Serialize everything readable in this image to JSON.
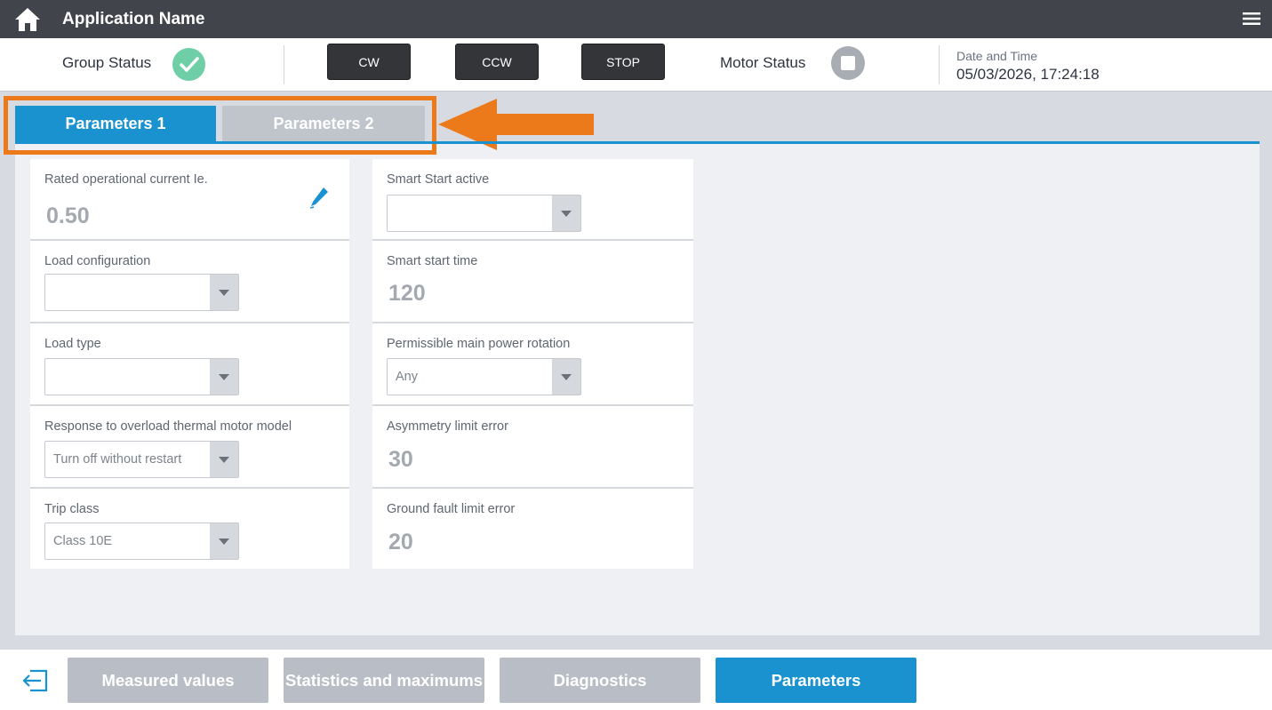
{
  "header": {
    "title": "Application Name",
    "home_icon": "home-icon",
    "menu_icon": "hamburger-menu-icon"
  },
  "status": {
    "group_label": "Group Status",
    "group_state_icon": "check-icon",
    "buttons": {
      "cw": "CW",
      "ccw": "CCW",
      "stop": "STOP"
    },
    "motor_label": "Motor Status",
    "motor_state_icon": "stop-square-icon",
    "datetime_label": "Date and Time",
    "datetime_value": "05/03/2026, 17:24:18"
  },
  "tabs": [
    {
      "label": "Parameters 1",
      "active": true
    },
    {
      "label": "Parameters 2",
      "active": false
    }
  ],
  "params_left": {
    "rated_current": {
      "label": "Rated operational current Ie.",
      "value": "0.50"
    },
    "load_configuration": {
      "label": "Load configuration",
      "value": ""
    },
    "load_type": {
      "label": "Load type",
      "value": ""
    },
    "overload_response": {
      "label": "Response to overload thermal motor model",
      "value": "Turn off without restart"
    },
    "trip_class": {
      "label": "Trip class",
      "value": "Class 10E"
    }
  },
  "params_right": {
    "smart_start_active": {
      "label": "Smart Start active",
      "value": ""
    },
    "smart_start_time": {
      "label": "Smart start time",
      "value": "120"
    },
    "power_rotation": {
      "label": "Permissible main power rotation",
      "value": "Any"
    },
    "asymmetry_limit": {
      "label": "Asymmetry limit error",
      "value": "30"
    },
    "ground_fault_limit": {
      "label": "Ground fault limit error",
      "value": "20"
    }
  },
  "footer": {
    "exit_icon": "exit-icon",
    "nav": {
      "measured": "Measured values",
      "statistics": "Statistics and maximums",
      "diagnostics": "Diagnostics",
      "parameters": "Parameters"
    },
    "active": "parameters"
  },
  "colors": {
    "accent": "#1a92cf",
    "highlight": "#ec7a1b",
    "ok": "#6ecfa7",
    "header": "#41444a"
  }
}
